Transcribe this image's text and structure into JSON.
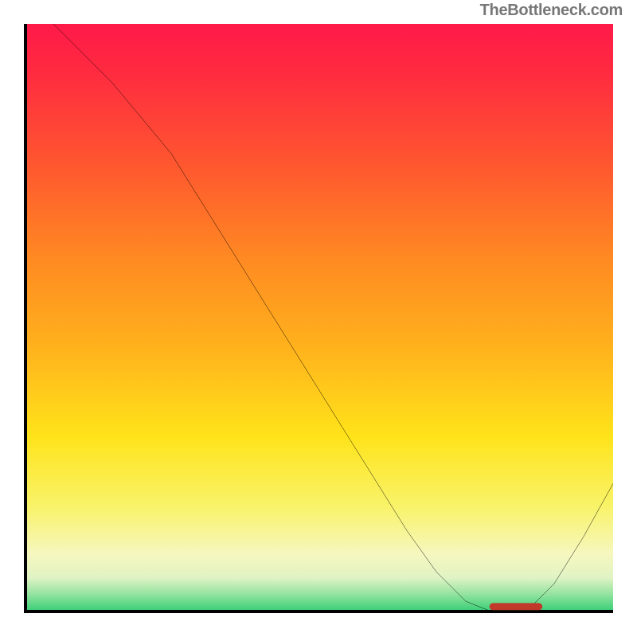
{
  "watermark": "TheBottleneck.com",
  "chart_data": {
    "type": "line",
    "title": "",
    "xlabel": "",
    "ylabel": "",
    "xlim": [
      0,
      100
    ],
    "ylim": [
      0,
      100
    ],
    "grid": false,
    "legend": false,
    "series": [
      {
        "name": "curve",
        "color": "#000000",
        "x": [
          5,
          10,
          15,
          20,
          25,
          30,
          35,
          40,
          45,
          50,
          55,
          60,
          65,
          70,
          75,
          80,
          85,
          90,
          95,
          100
        ],
        "y": [
          100,
          95,
          90,
          84,
          78,
          70,
          62,
          54,
          46,
          38,
          30,
          22,
          14,
          7,
          2,
          0,
          0,
          5,
          13,
          22
        ]
      }
    ],
    "annotations": [
      {
        "type": "marker",
        "name": "optimal-zone",
        "shape": "rounded-bar",
        "color": "#c0392b",
        "x_start": 79,
        "x_end": 88,
        "y": 0.5
      }
    ],
    "background_gradient": {
      "orientation": "vertical",
      "stops": [
        {
          "pos": 0.0,
          "color": "#ff1a49"
        },
        {
          "pos": 0.25,
          "color": "#ff5a2e"
        },
        {
          "pos": 0.55,
          "color": "#ffb21c"
        },
        {
          "pos": 0.78,
          "color": "#ffe31a"
        },
        {
          "pos": 0.9,
          "color": "#f6f7bf"
        },
        {
          "pos": 1.0,
          "color": "#2ecc71"
        }
      ]
    }
  }
}
